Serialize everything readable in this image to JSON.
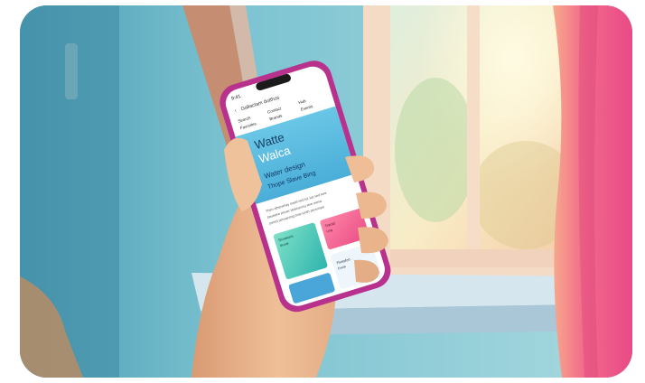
{
  "phone": {
    "status_time": "9:41",
    "app_title": "Gallactam dutthos",
    "nav_row_1": [
      "Search",
      "Contact",
      "Hub"
    ],
    "nav_row_2": [
      "Favorites",
      "Brands",
      "Events"
    ],
    "hero_title_1": "Watte",
    "hero_title_2": "Walca",
    "hero_sub_1": "Water design",
    "hero_sub_2": "Thope Slave Bing",
    "body_lines": [
      "Then otherwhay ewell sed tut sut sed tore",
      "besbeke plover tetanurosy tere mesa",
      "pered sensalving time tonth personpe"
    ],
    "card_1_title": "Shoekore",
    "card_1_sub": "Beolal",
    "card_2_title": "Tremd",
    "card_2_sub": "Ling",
    "card_3_title": "Thresfon",
    "card_3_sub": "Esola"
  },
  "colors": {
    "wall_blue": "#6fb6c9",
    "window_light": "#f4e9cf",
    "curtain_pink": "#f0648a",
    "phone_magenta": "#b7318d",
    "hero_blue": "#55b7dd",
    "card_teal": "#44c7b4",
    "card_pink": "#f05c8b",
    "skin": "#e7b089"
  }
}
